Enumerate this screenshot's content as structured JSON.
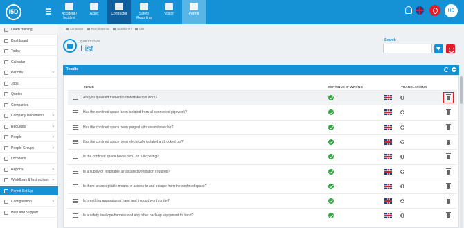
{
  "topbar": {
    "logo": "i5D",
    "modules": [
      {
        "label": "Accident / Incident",
        "state": "normal"
      },
      {
        "label": "Asset",
        "state": "normal"
      },
      {
        "label": "Contractor",
        "state": "active"
      },
      {
        "label": "Safety Reporting",
        "state": "normal"
      },
      {
        "label": "Visitor",
        "state": "normal"
      },
      {
        "label": "Permit",
        "state": "selected"
      }
    ],
    "avatar": "HD"
  },
  "sidebar": {
    "items": [
      {
        "label": "Learn training",
        "icon": "graduation-icon",
        "chevron": false,
        "head": true
      },
      {
        "label": "Dashboard",
        "icon": "dashboard-icon",
        "chevron": false
      },
      {
        "label": "Today",
        "icon": "calendar-day-icon",
        "chevron": false
      },
      {
        "label": "Calendar",
        "icon": "calendar-icon",
        "chevron": false
      },
      {
        "label": "Permits",
        "icon": "permit-icon",
        "chevron": true
      },
      {
        "label": "Jobs",
        "icon": "jobs-icon",
        "chevron": false
      },
      {
        "label": "Quotes",
        "icon": "quotes-icon",
        "chevron": false
      },
      {
        "label": "Companies",
        "icon": "companies-icon",
        "chevron": false
      },
      {
        "label": "Company Documents",
        "icon": "documents-icon",
        "chevron": true
      },
      {
        "label": "Requests",
        "icon": "requests-icon",
        "chevron": true
      },
      {
        "label": "People",
        "icon": "people-icon",
        "chevron": true
      },
      {
        "label": "People Groups",
        "icon": "people-groups-icon",
        "chevron": true
      },
      {
        "label": "Locations",
        "icon": "locations-icon",
        "chevron": false
      },
      {
        "label": "Reports",
        "icon": "reports-icon",
        "chevron": true
      },
      {
        "label": "Workflows & Instructions",
        "icon": "workflow-icon",
        "chevron": true
      },
      {
        "label": "Permit Set Up",
        "icon": "permit-setup-icon",
        "chevron": false,
        "active": true
      },
      {
        "label": "Configuration",
        "icon": "configuration-icon",
        "chevron": true
      },
      {
        "label": "Help and Support",
        "icon": "help-icon",
        "chevron": false
      }
    ]
  },
  "breadcrumb": [
    "Contractor",
    "Permit Set Up",
    "Questions",
    "List"
  ],
  "header": {
    "subtitle": "QUESTIONS",
    "title": "List"
  },
  "search": {
    "label": "Search",
    "placeholder": ""
  },
  "results": {
    "title": "Results",
    "columns": {
      "name": "NAME",
      "continue": "CONTINUE IF WRONG",
      "translations": "TRANSLATIONS"
    },
    "rows": [
      "Are you qualified trained to undertake this work?",
      "Has the confined space been isolated from all connected pipework?",
      "Has the confined space been purged with steam/water/air?",
      "Has the confined space been electrically isolated and locked out?",
      "Is the confined space below 30°C on full cooling?",
      "Is a supply of respirable air assured/ventilation required?",
      "Is there an acceptable means of access to and escape from the confined space?",
      "Is breathing apparatus at hand and in good worth order?",
      "Is a safety line/rope/harness and any other back-up equipment to hand?"
    ]
  },
  "colors": {
    "primary": "#1592d6",
    "danger": "#e21d2a",
    "success": "#2eaa3e"
  }
}
